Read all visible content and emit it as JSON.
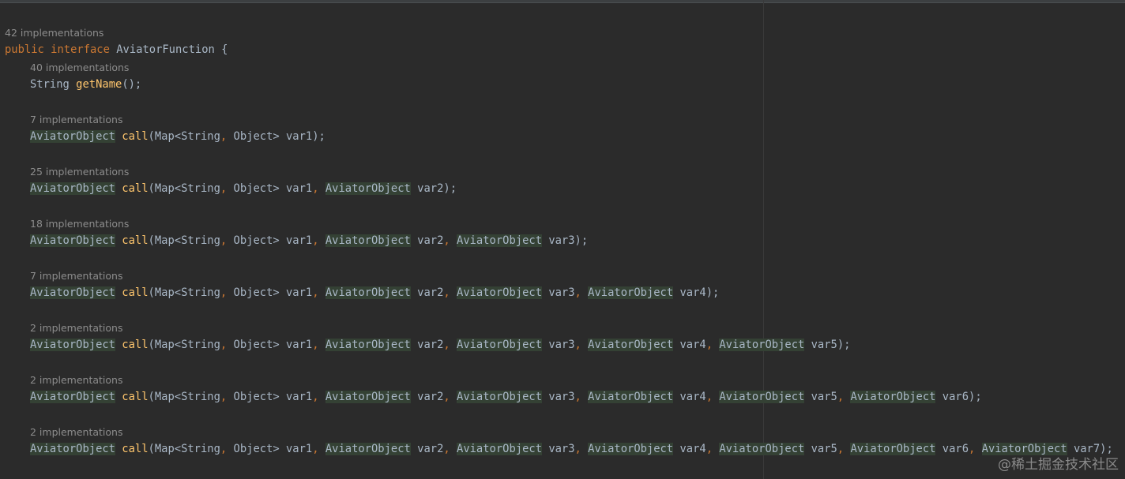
{
  "editor": {
    "interface_hint": "42 implementations",
    "decl": {
      "kw_public": "public",
      "kw_interface": "interface",
      "name": "AviatorFunction",
      "brace": "{"
    },
    "getname": {
      "hint": "40 implementations",
      "ret": "String",
      "fn": "getName",
      "tail": "();"
    },
    "methods": [
      {
        "hint": "7 implementations",
        "params": 0
      },
      {
        "hint": "25 implementations",
        "params": 1
      },
      {
        "hint": "18 implementations",
        "params": 2
      },
      {
        "hint": "7 implementations",
        "params": 3
      },
      {
        "hint": "2 implementations",
        "params": 4
      },
      {
        "hint": "2 implementations",
        "params": 5
      },
      {
        "hint": "2 implementations",
        "params": 6
      }
    ],
    "tokens": {
      "ret_type": "AviatorObject",
      "method_name": "call",
      "open": "(",
      "map_type": "Map<String",
      "comma": ",",
      "object_type": " Object>",
      "first_param": " var1",
      "param_type": "AviatorObject",
      "close": ");"
    },
    "param_names": [
      "var2",
      "var3",
      "var4",
      "var5",
      "var6",
      "var7"
    ]
  },
  "watermark": "@稀土掘金技术社区",
  "colors": {
    "background": "#2b2b2b",
    "keyword": "#cc7832",
    "function": "#ffc66d",
    "text": "#a9b7c6",
    "hint": "#8c8c8c",
    "highlight": "#344134"
  }
}
